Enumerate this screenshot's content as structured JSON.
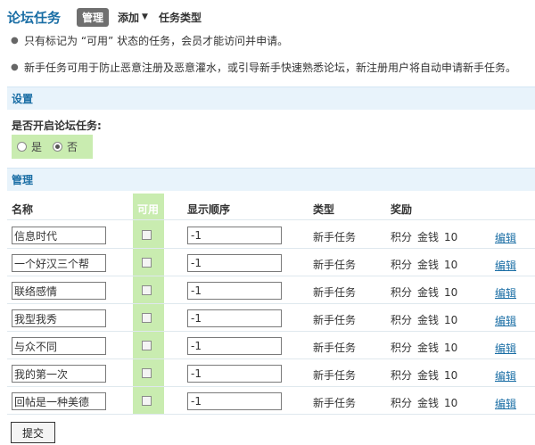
{
  "header": {
    "title": "论坛任务",
    "tabs": [
      {
        "label": "管理",
        "active": true
      },
      {
        "label": "添加",
        "dropdown": true
      },
      {
        "label": "任务类型"
      }
    ]
  },
  "tips": [
    "只有标记为 “可用” 状态的任务，会员才能访问并申请。",
    "新手任务可用于防止恶意注册及恶意灌水，或引导新手快速熟悉论坛，新注册用户将自动申请新手任务。"
  ],
  "settings": {
    "section_label": "设置",
    "question": "是否开启论坛任务:",
    "options": [
      {
        "label": "是",
        "selected": false
      },
      {
        "label": "否",
        "selected": true
      }
    ]
  },
  "manage": {
    "section_label": "管理",
    "columns": {
      "name": "名称",
      "enabled": "可用",
      "order": "显示顺序",
      "type": "类型",
      "reward": "奖励"
    },
    "rows": [
      {
        "name": "信息时代",
        "enabled": false,
        "order": "-1",
        "type": "新手任务",
        "reward_kind": "积分",
        "reward_currency": "金钱",
        "reward_amount": "10",
        "edit": "编辑"
      },
      {
        "name": "一个好汉三个帮",
        "enabled": false,
        "order": "-1",
        "type": "新手任务",
        "reward_kind": "积分",
        "reward_currency": "金钱",
        "reward_amount": "10",
        "edit": "编辑"
      },
      {
        "name": "联络感情",
        "enabled": false,
        "order": "-1",
        "type": "新手任务",
        "reward_kind": "积分",
        "reward_currency": "金钱",
        "reward_amount": "10",
        "edit": "编辑"
      },
      {
        "name": "我型我秀",
        "enabled": false,
        "order": "-1",
        "type": "新手任务",
        "reward_kind": "积分",
        "reward_currency": "金钱",
        "reward_amount": "10",
        "edit": "编辑"
      },
      {
        "name": "与众不同",
        "enabled": false,
        "order": "-1",
        "type": "新手任务",
        "reward_kind": "积分",
        "reward_currency": "金钱",
        "reward_amount": "10",
        "edit": "编辑"
      },
      {
        "name": "我的第一次",
        "enabled": false,
        "order": "-1",
        "type": "新手任务",
        "reward_kind": "积分",
        "reward_currency": "金钱",
        "reward_amount": "10",
        "edit": "编辑"
      },
      {
        "name": "回帖是一种美德",
        "enabled": false,
        "order": "-1",
        "type": "新手任务",
        "reward_kind": "积分",
        "reward_currency": "金钱",
        "reward_amount": "10",
        "edit": "编辑"
      }
    ],
    "submit_label": "提交"
  }
}
